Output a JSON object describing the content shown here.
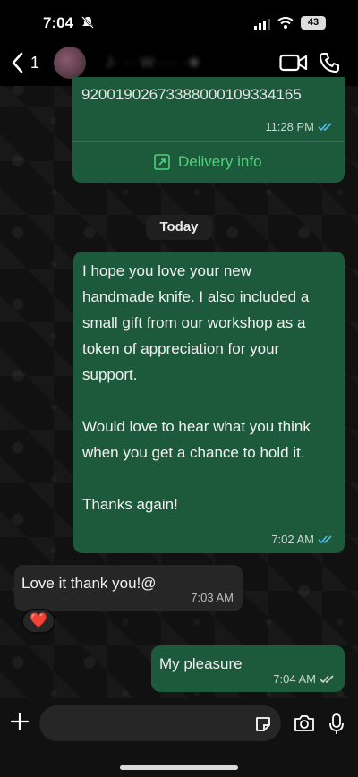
{
  "status_bar": {
    "time": "7:04",
    "battery": "43"
  },
  "header": {
    "back_count": "1",
    "contact_name": "J· ·· W···· ·❀"
  },
  "messages": {
    "previous": {
      "tracking_number": "9200190267338800010933416​5",
      "time": "11:28 PM",
      "delivery_link": "Delivery info"
    },
    "date_divider": "Today",
    "main": {
      "text": "I hope you love your new\nhandmade knife. I also included a\nsmall gift from our workshop as a\ntoken of appreciation for your\nsupport.\n\nWould love to hear what you think\nwhen you get a chance to hold it.\n\nThanks again!",
      "time": "7:02 AM"
    },
    "incoming": {
      "text": "Love it thank you!@",
      "time": "7:03 AM",
      "reaction": "❤️"
    },
    "reply": {
      "text": "My pleasure",
      "time": "7:04 AM"
    }
  },
  "colors": {
    "outgoing_bubble": "#1d5a3c",
    "incoming_bubble": "#262626",
    "read_ticks": "#53bdeb",
    "link": "#4fd17e"
  },
  "icons": [
    "bell-slash-icon",
    "signal-icon",
    "wifi-icon",
    "back-chevron-icon",
    "video-call-icon",
    "phone-call-icon",
    "external-link-icon",
    "read-receipt-icon",
    "plus-icon",
    "sticker-icon",
    "camera-icon",
    "microphone-icon"
  ]
}
